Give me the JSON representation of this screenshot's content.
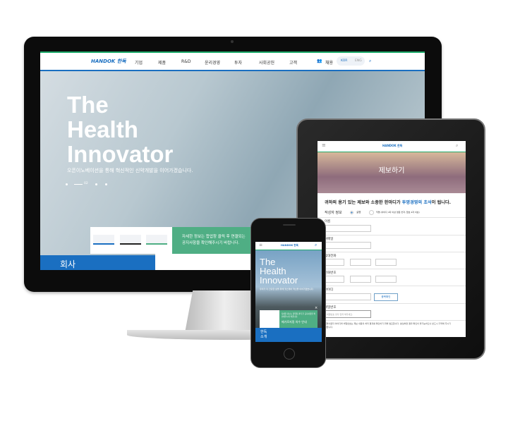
{
  "desktop": {
    "logo": "HANDOK 한독",
    "nav": [
      "기업",
      "제품",
      "R&D",
      "윤리경영",
      "투자",
      "사회공헌",
      "고객"
    ],
    "recruit": "채용",
    "lang": [
      "KOR",
      "ENG"
    ],
    "hero_title": "The\nHealth\nInnovator",
    "hero_sub": "오픈이노베이션을 통해 혁신적인 신약개발을 이어가겠습니다.",
    "slide_num": "02",
    "notice": "자세한 정보는 합업창 클릭 후 연결되는\n공지사항을 확인해주시기 바랍니다.",
    "about": "회사"
  },
  "tablet": {
    "logo": "HANDOK 한독",
    "banner": "제보하기",
    "headline_a": "귀하의 용기 있는 제보와 소중한 한마디가 ",
    "headline_b": "투명경영의 초석",
    "headline_c": "이 됩니다.",
    "writer_label": "작성자 정보",
    "opt_real": "실명",
    "opt_anon": "익명 (아이디 4자 이상 영문 숫자, 암호 4자 이상)",
    "fields": [
      "이름",
      "이메일",
      "휴대전화",
      "전화번호",
      "아이디"
    ],
    "dup_btn": "중복확인",
    "pw_label": "비밀번호",
    "pw_placeholder": "비밀번호 숫자 입력 해주세요.",
    "note": "익명사용자 아이디와 비밀번호는 제보 내용의 처리 결과를 확인하기 위해 필요합니다. 분실하면 결과 확인이 불가능하오니 반드시 기억해 주시기 바랍니다."
  },
  "phone": {
    "logo": "HANDOK 한독",
    "hero_title": "The\nHealth\nInnovator",
    "hero_sub": "우리가 더 건강한 삶을 위해 헬스케어 혁신을 이어가겠습니다.",
    "notice": "자세한 정보는 합업창 클릭 후 공지사항을 확인해주시기 바랍니다.",
    "notice_btn": "메가로지정 의수 안내",
    "about_a": "한독",
    "about_b": "소개"
  },
  "colors": {
    "green": "#4fae84",
    "blue": "#1a6fc1",
    "accent_link": "#1a6fc1"
  }
}
